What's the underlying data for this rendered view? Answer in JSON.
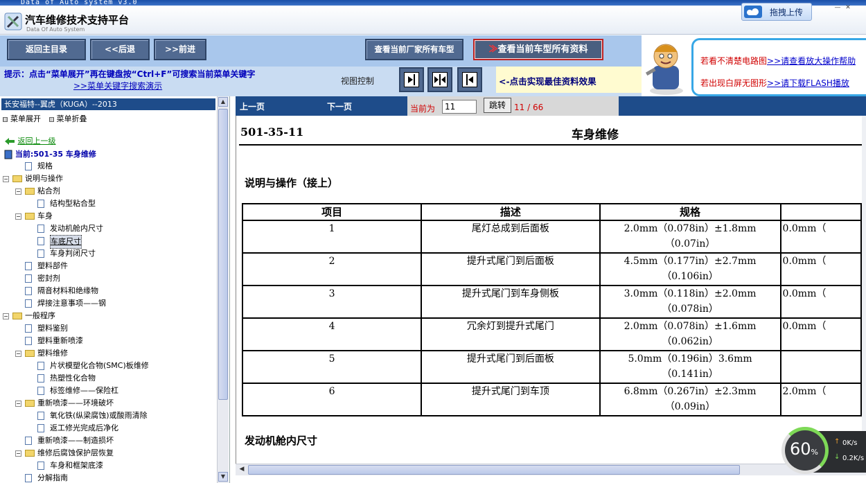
{
  "window": {
    "title": "Data of Auto system v3.0"
  },
  "app": {
    "title": "汽车维修技术支持平台",
    "subtitle": "Data Of Auto System",
    "upload_label": "拖拽上传"
  },
  "nav": {
    "home": "返回主目录",
    "back": "<<后退",
    "forward": ">>前进",
    "all_models": "查看当前厂家所有车型",
    "all_data_arrows": "≫",
    "all_data": "查看当前车型所有资料"
  },
  "hint": {
    "text": "提示：点击“菜单展开”再在键盘按“Ctrl+F”可搜索当前菜单关键字",
    "link": ">>菜单关键字搜索演示"
  },
  "view": {
    "label": "视图控制",
    "hint": "<-点击实现最佳资料效果"
  },
  "help": {
    "row1_red": "若看不清楚电路图",
    "row1_link": ">>请查看放大操作帮助",
    "row2_red": "若出现白屏无图形",
    "row2_link": ">>请下载FLASH播放"
  },
  "sidebar": {
    "model": "长安福特--翼虎（KUGA）--2013",
    "expand": "菜单展开",
    "collapse": "菜单折叠",
    "back_up": "返回上一级",
    "current": "当前:501-35 车身维修",
    "tree": [
      {
        "label": "规格",
        "type": "doc",
        "level": 1
      },
      {
        "label": "说明与操作",
        "type": "folder",
        "level": 0,
        "exp": "−"
      },
      {
        "label": "粘合剂",
        "type": "folder",
        "level": 1,
        "exp": "−"
      },
      {
        "label": "结构型粘合型",
        "type": "doc",
        "level": 2
      },
      {
        "label": "车身",
        "type": "folder",
        "level": 1,
        "exp": "−"
      },
      {
        "label": "发动机舱内尺寸",
        "type": "doc",
        "level": 2
      },
      {
        "label": "车底尺寸",
        "type": "doc",
        "level": 2,
        "selected": true
      },
      {
        "label": "车身判闭尺寸",
        "type": "doc",
        "level": 2
      },
      {
        "label": "塑料部件",
        "type": "doc",
        "level": 1
      },
      {
        "label": "密封剂",
        "type": "doc",
        "level": 1
      },
      {
        "label": "隔音材料和绝缘物",
        "type": "doc",
        "level": 1
      },
      {
        "label": "焊接注意事项——钢",
        "type": "doc",
        "level": 1
      },
      {
        "label": "一般程序",
        "type": "folder",
        "level": 0,
        "exp": "−"
      },
      {
        "label": "塑料鉴别",
        "type": "doc",
        "level": 1
      },
      {
        "label": "塑料重新喷漆",
        "type": "doc",
        "level": 1
      },
      {
        "label": "塑料维修",
        "type": "folder",
        "level": 1,
        "exp": "−"
      },
      {
        "label": "片状模塑化合物(SMC)板维修",
        "type": "doc",
        "level": 2
      },
      {
        "label": "热塑性化合物",
        "type": "doc",
        "level": 2
      },
      {
        "label": "标签维修——保险杠",
        "type": "doc",
        "level": 2
      },
      {
        "label": "重新喷漆——环境破坏",
        "type": "folder",
        "level": 1,
        "exp": "−"
      },
      {
        "label": "氧化铁(纵梁腐蚀)或酸雨清除",
        "type": "doc",
        "level": 2
      },
      {
        "label": "返工修光完成后净化",
        "type": "doc",
        "level": 2
      },
      {
        "label": "重新喷漆——制造损坏",
        "type": "doc",
        "level": 1
      },
      {
        "label": "维修后腐蚀保护层恢复",
        "type": "folder",
        "level": 1,
        "exp": "−"
      },
      {
        "label": "车身和框架底漆",
        "type": "doc",
        "level": 2
      },
      {
        "label": "分解指南",
        "type": "doc",
        "level": 1
      }
    ]
  },
  "pager": {
    "prev": "上一页",
    "next": "下一页",
    "current_label": "当前为",
    "current_value": "11",
    "jump": "跳转",
    "count": "11 / 66"
  },
  "doc": {
    "code": "501-35-11",
    "title": "车身维修",
    "section": "说明与操作（接上）",
    "next_section": "发动机舱内尺寸",
    "columns": [
      "项目",
      "描述",
      "规格",
      ""
    ],
    "rows": [
      {
        "item": "1",
        "desc": "尾灯总成到后面板",
        "spec1": "2.0mm（0.078in）±1.8mm",
        "spec2": "（0.07in）",
        "extra": "0.0mm（"
      },
      {
        "item": "2",
        "desc": "提升式尾门到后面板",
        "spec1": "4.5mm（0.177in）±2.7mm",
        "spec2": "（0.106in）",
        "extra": "0.0mm（"
      },
      {
        "item": "3",
        "desc": "提升式尾门到车身侧板",
        "spec1": "3.0mm（0.118in）±2.0mm",
        "spec2": "（0.078in）",
        "extra": "0.0mm（"
      },
      {
        "item": "4",
        "desc": "冗余灯到提升式尾门",
        "spec1": "2.0mm（0.078in）±1.6mm",
        "spec2": "（0.062in）",
        "extra": "0.0mm（"
      },
      {
        "item": "5",
        "desc": "提升式尾门到后面板",
        "spec1": "5.0mm（0.196in）3.6mm",
        "spec2": "（0.141in）",
        "extra": ""
      },
      {
        "item": "6",
        "desc": "提升式尾门到车顶",
        "spec1": "6.8mm（0.267in）±2.3mm",
        "spec2": "（0.09in）",
        "extra": "2.0mm（"
      }
    ]
  },
  "speed": {
    "percent": "60",
    "unit": "%",
    "up": "0K/s",
    "down": "0.2K/s"
  },
  "colors": {
    "nav_band": "#a9c7ec",
    "nav_button": "#516a91",
    "page_bar": "#1e4c8a",
    "hint_text": "#0000bb",
    "alert_red": "#d00000"
  }
}
